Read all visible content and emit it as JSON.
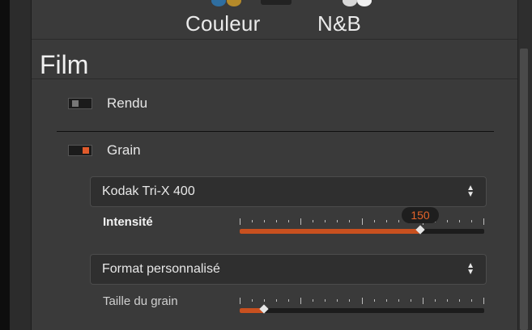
{
  "modes": {
    "color_label": "Couleur",
    "bw_label": "N&B"
  },
  "section": {
    "title": "Film"
  },
  "items": {
    "rendu": {
      "label": "Rendu",
      "enabled": false
    },
    "grain": {
      "label": "Grain",
      "enabled": true
    }
  },
  "grain": {
    "film_select": {
      "value": "Kodak Tri-X 400"
    },
    "intensity": {
      "label": "Intensité",
      "value": "150",
      "fraction": 0.74
    },
    "format_select": {
      "value": "Format personnalisé"
    },
    "grain_size": {
      "label": "Taille du grain",
      "fraction": 0.1
    }
  },
  "colors": {
    "accent": "#c8501f",
    "value_text": "#e4642a"
  }
}
